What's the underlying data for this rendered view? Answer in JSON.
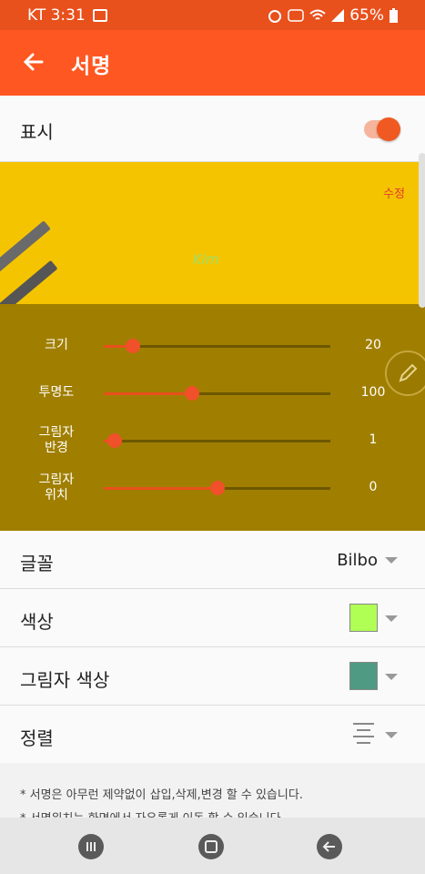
{
  "status": {
    "carrier_time": "KT 3:31",
    "battery": "65%"
  },
  "header": {
    "title": "서명"
  },
  "display": {
    "label": "표시",
    "enabled": true
  },
  "preview": {
    "edit_label": "수정",
    "signature_text": "Kim",
    "sliders": [
      {
        "label": "크기",
        "value": "20",
        "fraction": 0.13
      },
      {
        "label": "투명도",
        "value": "100",
        "fraction": 0.39
      },
      {
        "label": "그림자\n반경",
        "value": "1",
        "fraction": 0.05
      },
      {
        "label": "그림자\n위치",
        "value": "0",
        "fraction": 0.5
      }
    ]
  },
  "options": {
    "font": {
      "label": "글꼴",
      "value": "Bilbo"
    },
    "color": {
      "label": "색상",
      "swatch": "#b0ff55"
    },
    "shadow_color": {
      "label": "그림자 색상",
      "swatch": "#4f9a82"
    },
    "align": {
      "label": "정렬"
    }
  },
  "notes": [
    "* 서명은 아무런 제약없이 삽입,삭제,변경 할 수 있습니다.",
    "* 서명위치는 화면에서 자유롭게 이동 할 수 있습니다."
  ],
  "colors": {
    "accent": "#ff5722",
    "status": "#e8501c"
  },
  "icons": [
    "back-arrow-icon",
    "pencil-icon",
    "recent-apps-icon",
    "home-icon",
    "back-nav-icon"
  ]
}
